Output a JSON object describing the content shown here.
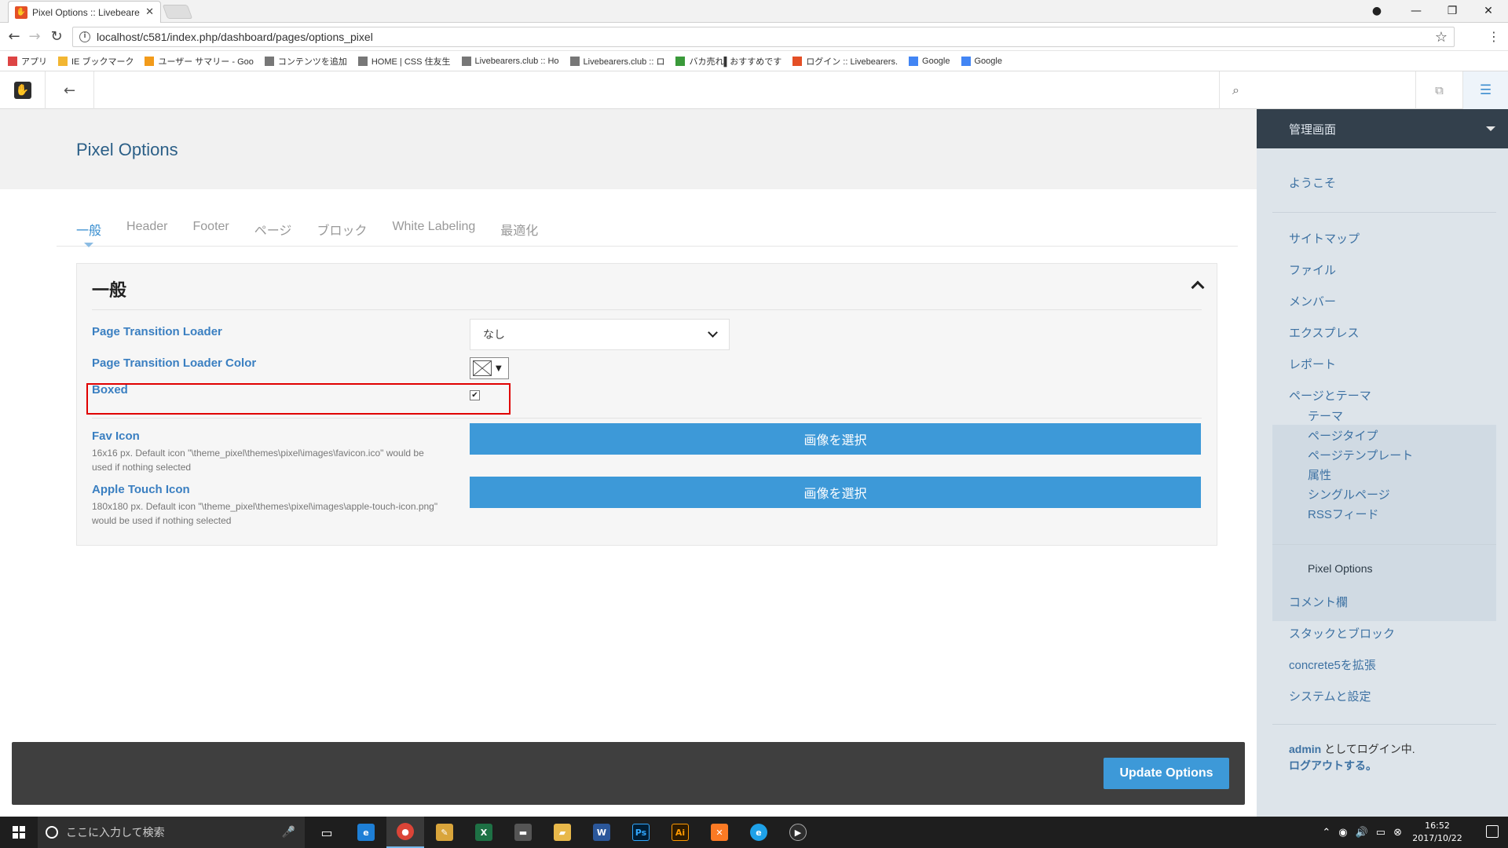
{
  "browser": {
    "tab_title": "Pixel Options :: Livebeare",
    "url": "localhost/c581/index.php/dashboard/pages/options_pixel",
    "bookmarks": [
      {
        "label": "アプリ",
        "color": "#d44"
      },
      {
        "label": "IE ブックマーク",
        "color": "#f2b632"
      },
      {
        "label": "ユーザー サマリー - Goo",
        "color": "#f29b1b"
      },
      {
        "label": "コンテンツを追加",
        "color": "#777"
      },
      {
        "label": "HOME | CSS 住友生",
        "color": "#777"
      },
      {
        "label": "Livebearers.club :: Ho",
        "color": "#777"
      },
      {
        "label": "Livebearers.club :: ロ",
        "color": "#777"
      },
      {
        "label": "バカ売れ▌おすすめです",
        "color": "#3a9a3a"
      },
      {
        "label": "ログイン :: Livebearers.",
        "color": "#e44f26"
      },
      {
        "label": "Google",
        "color": "#4285f4"
      },
      {
        "label": "Google",
        "color": "#4285f4"
      }
    ]
  },
  "page": {
    "title": "Pixel Options",
    "tabs": [
      "一般",
      "Header",
      "Footer",
      "ページ",
      "ブロック",
      "White Labeling",
      "最適化"
    ],
    "active_tab": "一般"
  },
  "panel": {
    "title": "一般",
    "page_transition_loader": {
      "label": "Page Transition Loader",
      "value": "なし"
    },
    "loader_color": {
      "label": "Page Transition Loader Color"
    },
    "boxed": {
      "label": "Boxed",
      "checked": true
    },
    "fav_icon": {
      "label": "Fav Icon",
      "help": "16x16 px. Default icon \"\\theme_pixel\\themes\\pixel\\images\\favicon.ico\" would be used if nothing selected",
      "button": "画像を選択"
    },
    "apple_touch_icon": {
      "label": "Apple Touch Icon",
      "help": "180x180 px. Default icon \"\\theme_pixel\\themes\\pixel\\images\\apple-touch-icon.png\" would be used if nothing selected",
      "button": "画像を選択"
    }
  },
  "actions": {
    "update": "Update Options"
  },
  "dashboard": {
    "header": "管理画面",
    "welcome": "ようこそ",
    "items": [
      "サイトマップ",
      "ファイル",
      "メンバー",
      "エクスプレス",
      "レポート",
      "ページとテーマ"
    ],
    "subitems": [
      "テーマ",
      "ページタイプ",
      "ページテンプレート",
      "属性",
      "シングルページ",
      "RSSフィード"
    ],
    "current": "Pixel Options",
    "items_after": [
      "コメント欄",
      "スタックとブロック",
      "concrete5を拡張",
      "システムと設定"
    ],
    "login_user": "admin",
    "login_suffix": " としてログイン中.",
    "logout": "ログアウトする。"
  },
  "taskbar": {
    "search_placeholder": "ここに入力して検索",
    "time": "16:52",
    "date": "2017/10/22"
  },
  "colors": {
    "accent": "#3d99d8",
    "label_blue": "#3a7fc1",
    "highlight_red": "#e00000",
    "dash_header": "#33404c"
  }
}
